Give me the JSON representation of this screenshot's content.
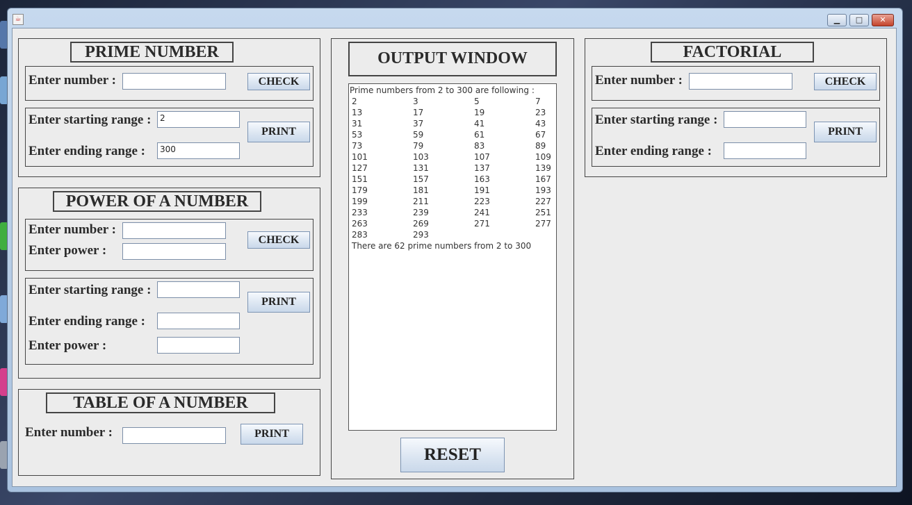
{
  "prime": {
    "title": "PRIME NUMBER",
    "number_label": "Enter number :",
    "number_value": "",
    "check_label": "CHECK",
    "start_label": "Enter starting range :",
    "start_value": "2",
    "end_label": "Enter ending range :",
    "end_value": "300",
    "print_label": "PRINT"
  },
  "power": {
    "title": "POWER OF A NUMBER",
    "number_label": "Enter number :",
    "power_label": "Enter power :",
    "check_label": "CHECK",
    "start_label": "Enter starting range :",
    "end_label": "Enter ending range :",
    "power2_label": "Enter power :",
    "print_label": "PRINT"
  },
  "table": {
    "title": "TABLE OF A NUMBER",
    "number_label": "Enter number :",
    "print_label": "PRINT"
  },
  "output": {
    "title": "OUTPUT WINDOW",
    "header": "Prime numbers from 2 to 300 are following :",
    "primes": [
      "2",
      "3",
      "5",
      "7",
      "13",
      "17",
      "19",
      "23",
      "31",
      "37",
      "41",
      "43",
      "53",
      "59",
      "61",
      "67",
      "73",
      "79",
      "83",
      "89",
      "101",
      "103",
      "107",
      "109",
      "127",
      "131",
      "137",
      "139",
      "151",
      "157",
      "163",
      "167",
      "179",
      "181",
      "191",
      "193",
      "199",
      "211",
      "223",
      "227",
      "233",
      "239",
      "241",
      "251",
      "263",
      "269",
      "271",
      "277",
      "283",
      "293"
    ],
    "footer": "There are 62 prime numbers from 2 to 300",
    "reset_label": "RESET"
  },
  "factorial": {
    "title": "FACTORIAL",
    "number_label": "Enter number :",
    "check_label": "CHECK",
    "start_label": "Enter starting range :",
    "end_label": "Enter ending range :",
    "print_label": "PRINT"
  },
  "window": {
    "minimize_icon": "minimize-icon",
    "maximize_icon": "maximize-icon",
    "close_icon": "close-icon",
    "minimize_glyph": "▁",
    "maximize_glyph": "□",
    "close_glyph": "✕"
  }
}
